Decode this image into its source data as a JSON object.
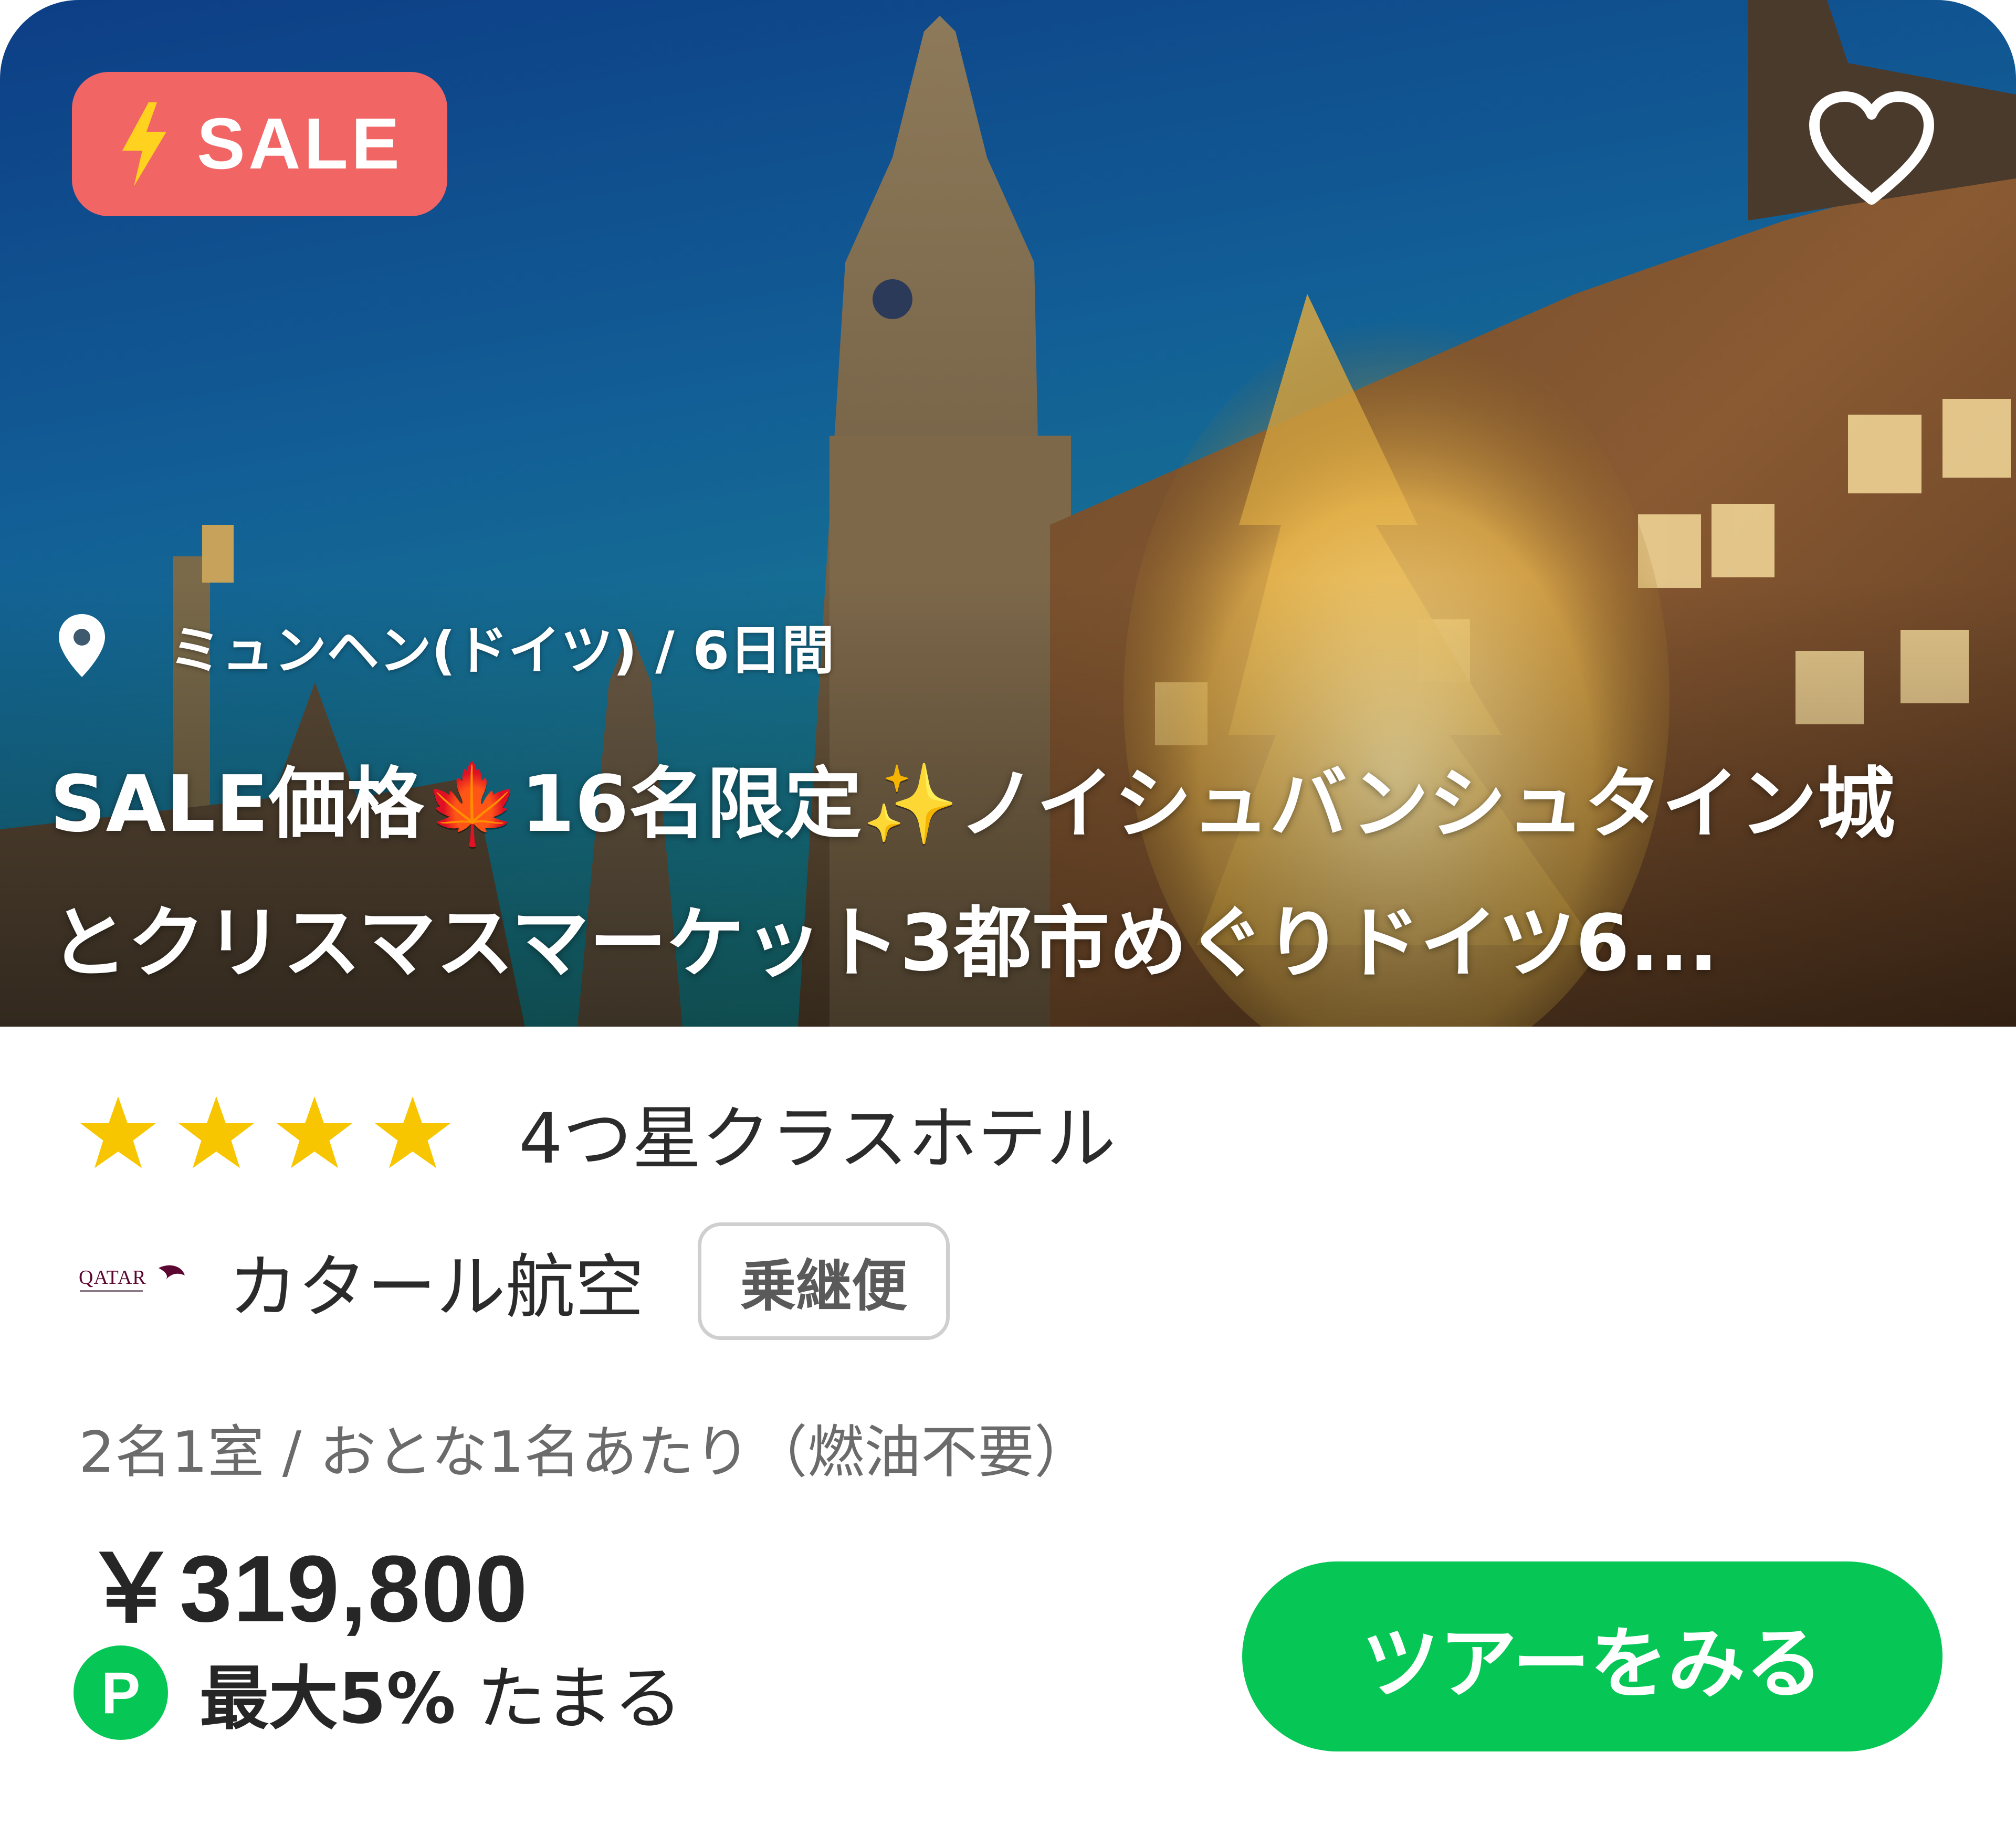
{
  "hero": {
    "sale_badge": "SALE",
    "location": "ミュンヘン(ドイツ) / 6日間",
    "title": "SALE価格🍁16名限定✨ノイシュバンシュタイン城とクリスマスマーケット3都市めぐりドイツ6..."
  },
  "hotel": {
    "star_count": 4,
    "class_label": "4つ星クラスホテル"
  },
  "airline": {
    "logo_text": "QATAR",
    "name": "カタール航空",
    "flight_type": "乗継便"
  },
  "pricing": {
    "note": "2名1室 / おとな1名あたり（燃油不要）",
    "price": "￥319,800"
  },
  "points": {
    "icon_letter": "P",
    "rate": "最大5%",
    "suffix": "たまる"
  },
  "cta": {
    "label": "ツアーをみる"
  },
  "colors": {
    "sale_badge": "#f16565",
    "accent_green": "#06c755",
    "star_yellow": "#f7c600"
  }
}
